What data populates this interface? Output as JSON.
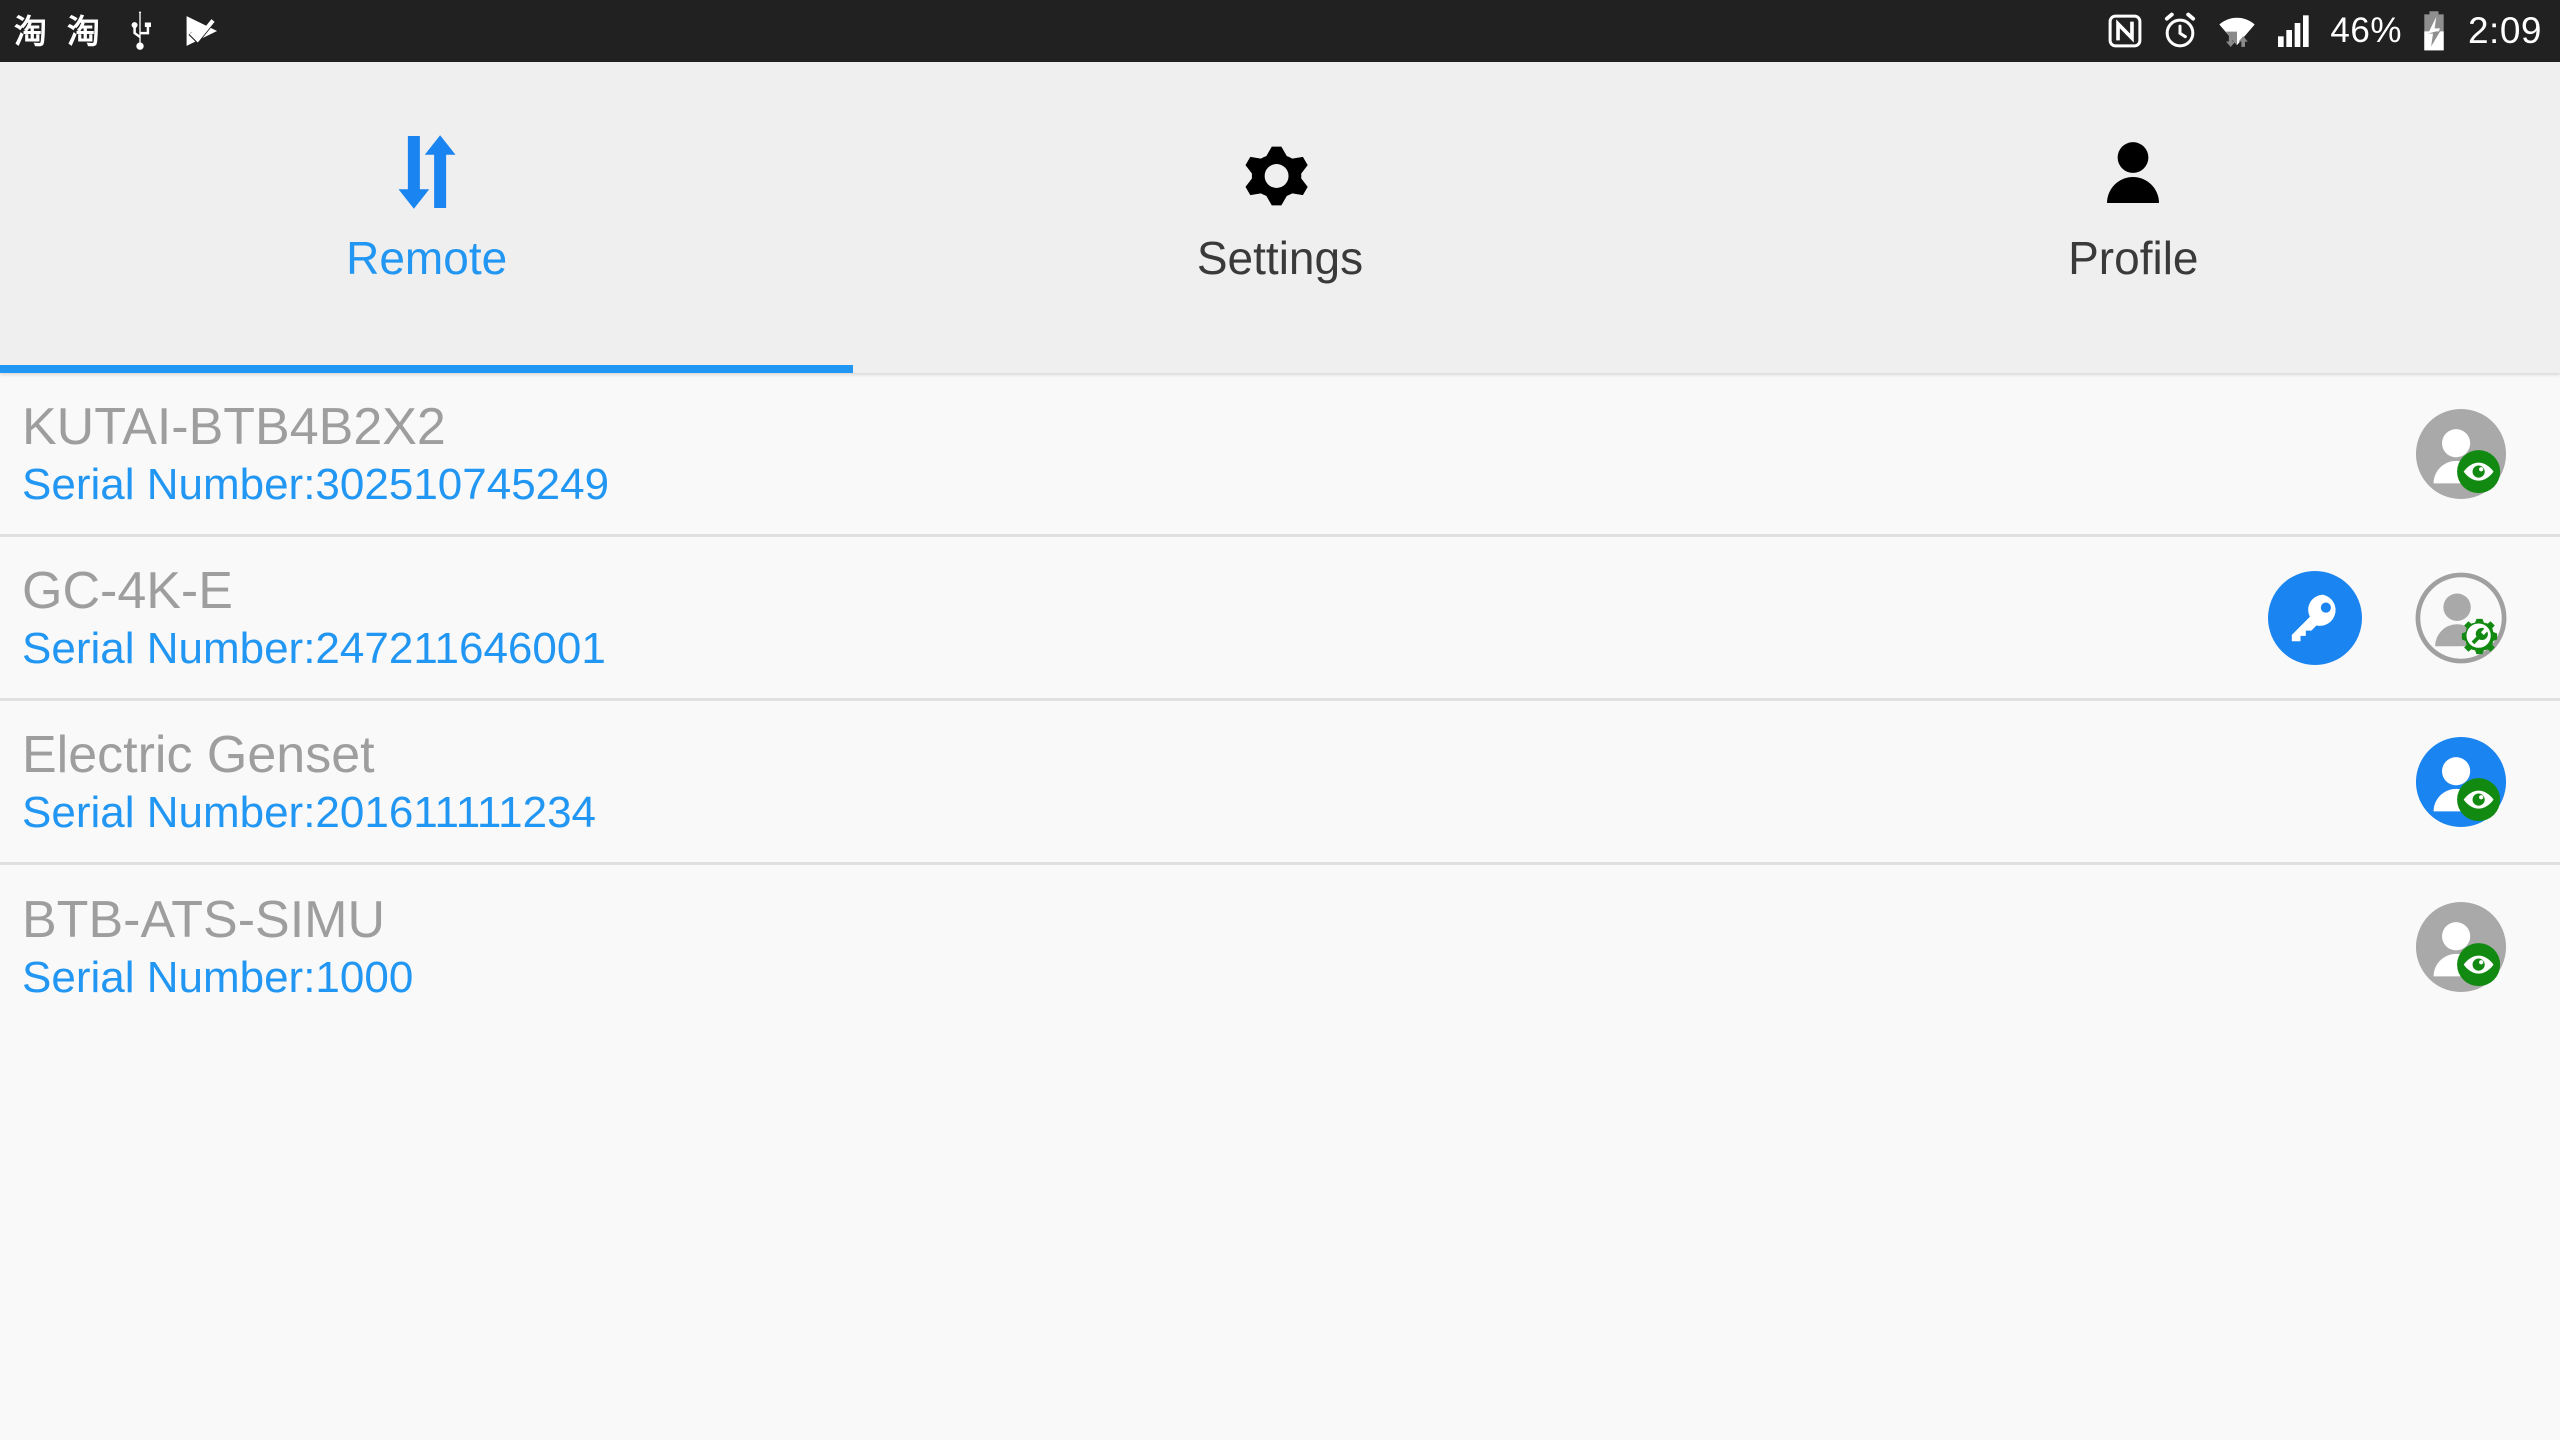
{
  "statusbar": {
    "left_icons": [
      {
        "name": "taobao-notification-icon",
        "glyph": "淘"
      },
      {
        "name": "taobao-notification-icon-2",
        "glyph": "淘"
      },
      {
        "name": "usb-icon",
        "glyph": "usb"
      },
      {
        "name": "checkmark-play-icon",
        "glyph": "check"
      }
    ],
    "right_icons": [
      {
        "name": "nfc-icon"
      },
      {
        "name": "alarm-clock-icon"
      },
      {
        "name": "wifi-icon"
      },
      {
        "name": "signal-bars-icon"
      },
      {
        "name": "battery-charging-icon"
      }
    ],
    "battery_percent": "46%",
    "clock": "2:09",
    "background_color": "#212121",
    "foreground_color": "#ffffff"
  },
  "tabs": [
    {
      "label": "Remote",
      "icon": "sync-arrows-icon",
      "active": true
    },
    {
      "label": "Settings",
      "icon": "gear-icon",
      "active": false
    },
    {
      "label": "Profile",
      "icon": "person-icon",
      "active": false
    }
  ],
  "colors": {
    "accent": "#2196f3",
    "tab_bar_bg": "#efefef",
    "list_bg": "#f9f9f9",
    "title_gray": "#9e9e9e",
    "badge_green": "#128a12",
    "avatar_gray": "#a9a9a9",
    "avatar_blue": "#1a84f0"
  },
  "devices": [
    {
      "name": "KUTAI-BTB4B2X2",
      "serial": "Serial Number:302510745249",
      "has_key_button": false,
      "avatar_style": "filled-gray",
      "badge": "eye-icon"
    },
    {
      "name": "GC-4K-E",
      "serial": "Serial Number:247211646001",
      "has_key_button": true,
      "key_icon": "key-icon",
      "avatar_style": "outlined-gray",
      "badge": "gear-wrench-icon"
    },
    {
      "name": "Electric Genset",
      "serial": "Serial Number:201611111234",
      "has_key_button": false,
      "avatar_style": "filled-blue",
      "badge": "eye-icon"
    },
    {
      "name": "BTB-ATS-SIMU",
      "serial": "Serial Number:1000",
      "has_key_button": false,
      "avatar_style": "filled-gray",
      "badge": "eye-icon"
    }
  ]
}
